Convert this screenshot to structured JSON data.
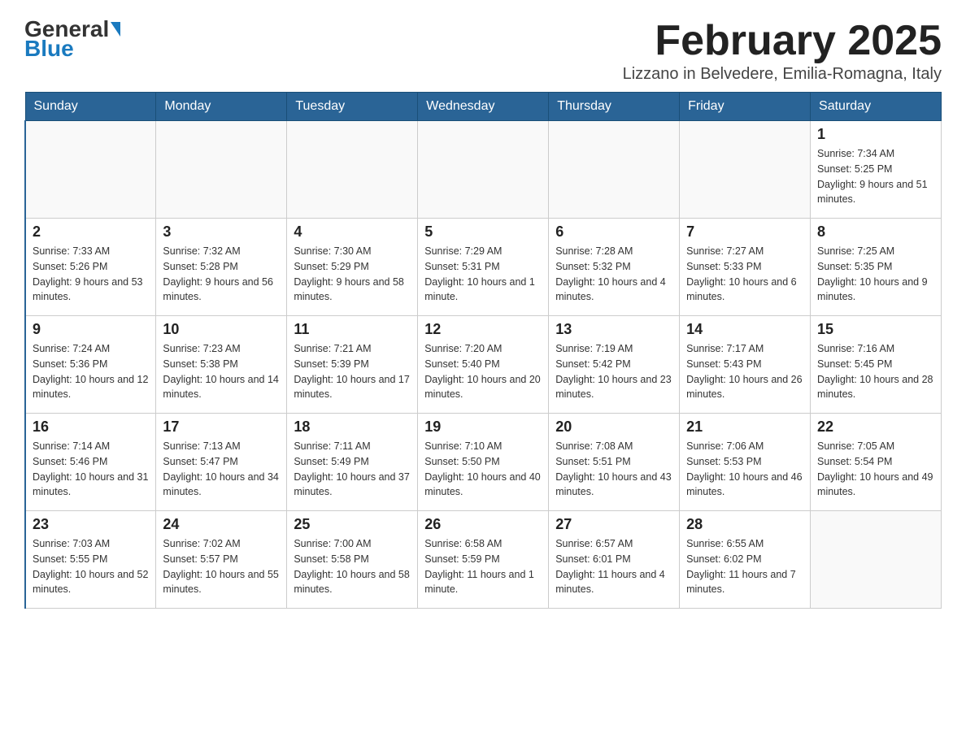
{
  "header": {
    "logo_general": "General",
    "logo_blue": "Blue",
    "title": "February 2025",
    "subtitle": "Lizzano in Belvedere, Emilia-Romagna, Italy"
  },
  "days_of_week": [
    "Sunday",
    "Monday",
    "Tuesday",
    "Wednesday",
    "Thursday",
    "Friday",
    "Saturday"
  ],
  "weeks": [
    [
      {
        "day": "",
        "info": ""
      },
      {
        "day": "",
        "info": ""
      },
      {
        "day": "",
        "info": ""
      },
      {
        "day": "",
        "info": ""
      },
      {
        "day": "",
        "info": ""
      },
      {
        "day": "",
        "info": ""
      },
      {
        "day": "1",
        "info": "Sunrise: 7:34 AM\nSunset: 5:25 PM\nDaylight: 9 hours and 51 minutes."
      }
    ],
    [
      {
        "day": "2",
        "info": "Sunrise: 7:33 AM\nSunset: 5:26 PM\nDaylight: 9 hours and 53 minutes."
      },
      {
        "day": "3",
        "info": "Sunrise: 7:32 AM\nSunset: 5:28 PM\nDaylight: 9 hours and 56 minutes."
      },
      {
        "day": "4",
        "info": "Sunrise: 7:30 AM\nSunset: 5:29 PM\nDaylight: 9 hours and 58 minutes."
      },
      {
        "day": "5",
        "info": "Sunrise: 7:29 AM\nSunset: 5:31 PM\nDaylight: 10 hours and 1 minute."
      },
      {
        "day": "6",
        "info": "Sunrise: 7:28 AM\nSunset: 5:32 PM\nDaylight: 10 hours and 4 minutes."
      },
      {
        "day": "7",
        "info": "Sunrise: 7:27 AM\nSunset: 5:33 PM\nDaylight: 10 hours and 6 minutes."
      },
      {
        "day": "8",
        "info": "Sunrise: 7:25 AM\nSunset: 5:35 PM\nDaylight: 10 hours and 9 minutes."
      }
    ],
    [
      {
        "day": "9",
        "info": "Sunrise: 7:24 AM\nSunset: 5:36 PM\nDaylight: 10 hours and 12 minutes."
      },
      {
        "day": "10",
        "info": "Sunrise: 7:23 AM\nSunset: 5:38 PM\nDaylight: 10 hours and 14 minutes."
      },
      {
        "day": "11",
        "info": "Sunrise: 7:21 AM\nSunset: 5:39 PM\nDaylight: 10 hours and 17 minutes."
      },
      {
        "day": "12",
        "info": "Sunrise: 7:20 AM\nSunset: 5:40 PM\nDaylight: 10 hours and 20 minutes."
      },
      {
        "day": "13",
        "info": "Sunrise: 7:19 AM\nSunset: 5:42 PM\nDaylight: 10 hours and 23 minutes."
      },
      {
        "day": "14",
        "info": "Sunrise: 7:17 AM\nSunset: 5:43 PM\nDaylight: 10 hours and 26 minutes."
      },
      {
        "day": "15",
        "info": "Sunrise: 7:16 AM\nSunset: 5:45 PM\nDaylight: 10 hours and 28 minutes."
      }
    ],
    [
      {
        "day": "16",
        "info": "Sunrise: 7:14 AM\nSunset: 5:46 PM\nDaylight: 10 hours and 31 minutes."
      },
      {
        "day": "17",
        "info": "Sunrise: 7:13 AM\nSunset: 5:47 PM\nDaylight: 10 hours and 34 minutes."
      },
      {
        "day": "18",
        "info": "Sunrise: 7:11 AM\nSunset: 5:49 PM\nDaylight: 10 hours and 37 minutes."
      },
      {
        "day": "19",
        "info": "Sunrise: 7:10 AM\nSunset: 5:50 PM\nDaylight: 10 hours and 40 minutes."
      },
      {
        "day": "20",
        "info": "Sunrise: 7:08 AM\nSunset: 5:51 PM\nDaylight: 10 hours and 43 minutes."
      },
      {
        "day": "21",
        "info": "Sunrise: 7:06 AM\nSunset: 5:53 PM\nDaylight: 10 hours and 46 minutes."
      },
      {
        "day": "22",
        "info": "Sunrise: 7:05 AM\nSunset: 5:54 PM\nDaylight: 10 hours and 49 minutes."
      }
    ],
    [
      {
        "day": "23",
        "info": "Sunrise: 7:03 AM\nSunset: 5:55 PM\nDaylight: 10 hours and 52 minutes."
      },
      {
        "day": "24",
        "info": "Sunrise: 7:02 AM\nSunset: 5:57 PM\nDaylight: 10 hours and 55 minutes."
      },
      {
        "day": "25",
        "info": "Sunrise: 7:00 AM\nSunset: 5:58 PM\nDaylight: 10 hours and 58 minutes."
      },
      {
        "day": "26",
        "info": "Sunrise: 6:58 AM\nSunset: 5:59 PM\nDaylight: 11 hours and 1 minute."
      },
      {
        "day": "27",
        "info": "Sunrise: 6:57 AM\nSunset: 6:01 PM\nDaylight: 11 hours and 4 minutes."
      },
      {
        "day": "28",
        "info": "Sunrise: 6:55 AM\nSunset: 6:02 PM\nDaylight: 11 hours and 7 minutes."
      },
      {
        "day": "",
        "info": ""
      }
    ]
  ]
}
